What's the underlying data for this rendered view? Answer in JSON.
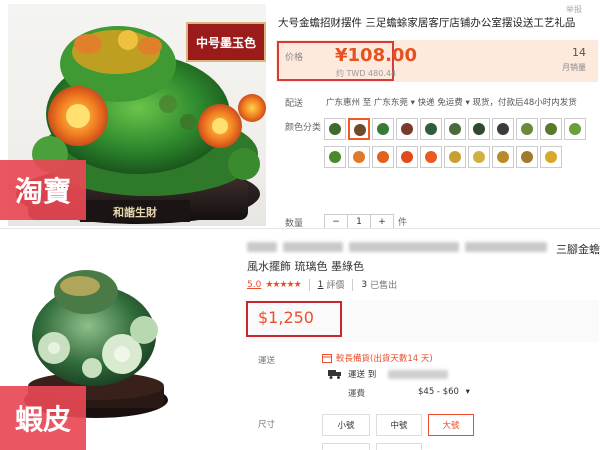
{
  "taobao": {
    "badge": "中号墨玉色",
    "site_label": "淘寶",
    "photo_caption": "和諧生財",
    "favorite_text": "举报",
    "title": "大号金蟾招财摆件 三足蟾蜍家居客厅店铺办公室摆设送工艺礼品",
    "price_label": "价格",
    "price": "¥108.00",
    "price_twd": "约 TWD 480.44",
    "sold_count": "14",
    "sold_label": "月销量",
    "shipping_label": "配送",
    "shipping_text": "广东惠州 至  广东东莞  ▾   快递 免运费 ▾   现货，付款后48小时内发货",
    "color_label": "颜色分类",
    "qty_label": "数量",
    "qty_minus": "−",
    "qty_value": "1",
    "qty_plus": "+",
    "qty_unit": "件",
    "swatch_colors": [
      "#3e6a2e",
      "#6b4b2a",
      "#3a7a34",
      "#7a3a2a",
      "#2f5f3a",
      "#4a6a3a",
      "#2e4a2e",
      "#3b3b3b",
      "#6a8a3a",
      "#5a7a2a",
      "#6aa03a",
      "#4a8a2a",
      "#e07a2a",
      "#e0621e",
      "#e04a1a",
      "#e85a22",
      "#c8a030",
      "#d0b040",
      "#b88a2a",
      "#a07a2a",
      "#d8a82a"
    ]
  },
  "shopee": {
    "site_label": "蝦皮",
    "title_end": "三腳金蟾",
    "title_line2": "風水擺飾 琉璃色 墨綠色",
    "rating_value": "5.0",
    "rating_stars": "★★★★★",
    "reviews_count": "1",
    "reviews_label": "評價",
    "sold_count": "3",
    "sold_label": "已售出",
    "price": "$1,250",
    "shipping_label": "運送",
    "shipping_note": "較長備貨(出貨天數14 天)",
    "ship_to_label": "運送 到",
    "fee_label": "運費",
    "fee_value": "$45 - $60",
    "size_label": "尺寸",
    "size_options": [
      "小號",
      "中號",
      "大號"
    ]
  },
  "colors": {
    "taobao_accent": "#e5521f",
    "shopee_accent": "#ee4d2d",
    "highlight_red": "#d8393b",
    "site_label_bg": "#e84854"
  }
}
